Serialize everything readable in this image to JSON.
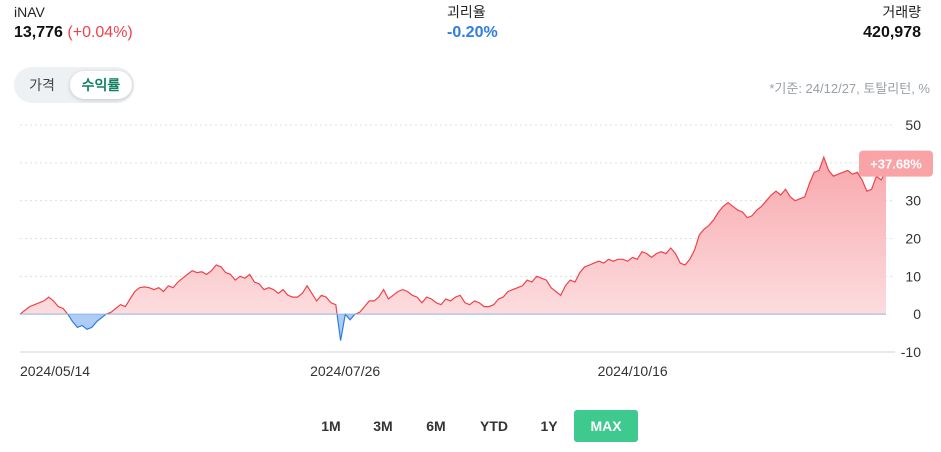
{
  "stats": {
    "inav": {
      "label": "iNAV",
      "value": "13,776",
      "change": "(+0.04%)"
    },
    "tracking_error": {
      "label": "괴리율",
      "value": "-0.20%"
    },
    "volume": {
      "label": "거래량",
      "value": "420,978"
    }
  },
  "toggle": {
    "price_label": "가격",
    "return_label": "수익률",
    "selected": "수익률"
  },
  "basis_note": "*기준: 24/12/27, 토탈리턴, %",
  "periods": [
    "1M",
    "3M",
    "6M",
    "YTD",
    "1Y",
    "MAX"
  ],
  "active_period": "MAX",
  "colors": {
    "positive": "#f0424a",
    "negative": "#2f7de1",
    "accent": "#3ec98f",
    "badge": "#f9a3a7"
  },
  "chart_data": {
    "type": "area",
    "x_tick_labels": [
      "2024/05/14",
      "2024/07/26",
      "2024/10/16"
    ],
    "y_ticks": [
      50,
      40,
      30,
      20,
      10,
      0,
      -10
    ],
    "ylim": [
      -10,
      50
    ],
    "grid": true,
    "last_value_label": "+37.68%",
    "series": [
      {
        "values": [
          0.0,
          1.0,
          2.0,
          2.5,
          3.0,
          3.5,
          4.5,
          3.5,
          2.0,
          1.5,
          0.0,
          -2.0,
          -3.5,
          -3.0,
          -4.0,
          -3.5,
          -2.0,
          -1.0,
          0.0,
          0.5,
          1.5,
          2.5,
          2.0,
          4.0,
          6.0,
          7.0,
          7.2,
          7.0,
          6.5,
          7.0,
          6.0,
          7.5,
          7.0,
          8.5,
          9.5,
          10.5,
          11.5,
          11.0,
          11.2,
          10.5,
          11.5,
          13.0,
          12.5,
          11.0,
          10.5,
          9.0,
          10.0,
          9.5,
          10.5,
          8.5,
          8.0,
          6.5,
          7.0,
          6.5,
          5.5,
          6.5,
          5.0,
          4.5,
          4.5,
          5.5,
          7.5,
          5.5,
          3.5,
          5.0,
          4.5,
          3.0,
          2.5,
          -7.0,
          0.0,
          -1.5,
          0.0,
          0.5,
          2.0,
          3.5,
          3.5,
          4.5,
          6.5,
          4.0,
          5.0,
          6.0,
          6.5,
          6.0,
          5.0,
          4.5,
          3.0,
          4.5,
          4.0,
          3.0,
          2.5,
          4.0,
          3.5,
          4.5,
          5.0,
          3.0,
          2.5,
          3.5,
          3.0,
          2.0,
          2.0,
          2.5,
          4.0,
          4.5,
          6.0,
          6.5,
          7.0,
          7.5,
          9.0,
          8.5,
          10.0,
          9.5,
          9.0,
          7.0,
          6.0,
          5.0,
          7.5,
          9.0,
          8.5,
          11.0,
          12.5,
          13.0,
          13.5,
          14.0,
          13.5,
          14.5,
          14.0,
          14.5,
          14.5,
          14.0,
          15.0,
          14.5,
          16.5,
          16.0,
          15.0,
          16.0,
          16.5,
          16.0,
          17.5,
          16.0,
          13.5,
          13.0,
          14.5,
          17.0,
          21.0,
          22.5,
          23.5,
          25.0,
          27.0,
          28.5,
          29.5,
          28.5,
          27.5,
          27.0,
          25.5,
          26.0,
          27.5,
          28.5,
          30.0,
          31.5,
          32.5,
          31.5,
          33.0,
          31.0,
          30.0,
          30.5,
          31.0,
          34.5,
          37.5,
          38.0,
          41.5,
          38.0,
          36.5,
          37.0,
          37.5,
          38.0,
          37.0,
          37.5,
          35.5,
          32.5,
          33.0,
          36.5,
          35.5,
          37.68
        ]
      }
    ]
  }
}
